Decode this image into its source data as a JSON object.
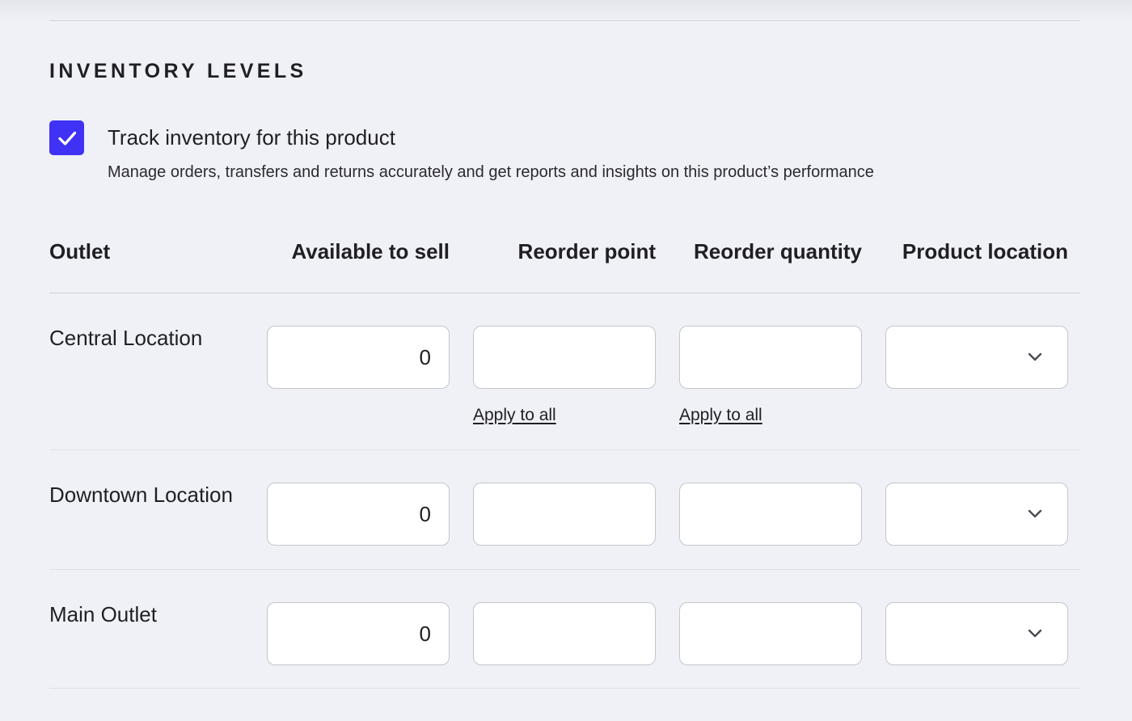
{
  "section": {
    "title": "INVENTORY LEVELS"
  },
  "track": {
    "checked": true,
    "label": "Track inventory for this product",
    "help": "Manage orders, transfers and returns accurately and get reports and insights on this product’s performance"
  },
  "table": {
    "headers": {
      "outlet": "Outlet",
      "available": "Available to sell",
      "reorder_point": "Reorder point",
      "reorder_quantity": "Reorder quantity",
      "product_location": "Product location"
    },
    "apply_to_all_label": "Apply to all",
    "rows": [
      {
        "outlet": "Central Location",
        "available": "0",
        "reorder_point": "",
        "reorder_quantity": "",
        "product_location": ""
      },
      {
        "outlet": "Downtown Location",
        "available": "0",
        "reorder_point": "",
        "reorder_quantity": "",
        "product_location": ""
      },
      {
        "outlet": "Main Outlet",
        "available": "0",
        "reorder_point": "",
        "reorder_quantity": "",
        "product_location": ""
      }
    ]
  },
  "icons": {
    "checkbox": "check-icon",
    "dropdown": "chevron-down-icon"
  },
  "colors": {
    "accent": "#3f32f5",
    "background": "#f0f1f6"
  }
}
